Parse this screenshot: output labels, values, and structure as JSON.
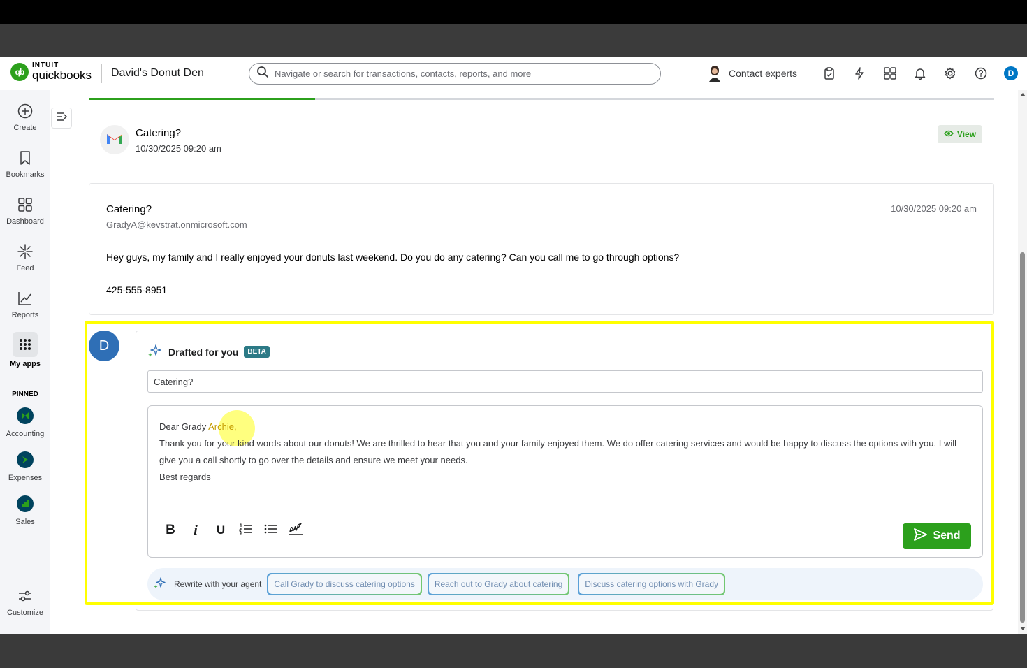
{
  "header": {
    "logo_top": "INTUIT",
    "logo_bottom": "quickbooks",
    "company": "David's Donut Den",
    "search_placeholder": "Navigate or search for transactions, contacts, reports, and more",
    "contact_experts": "Contact experts",
    "user_initial": "D"
  },
  "sidebar": {
    "items": [
      {
        "label": "Create",
        "icon": "plus-circle-icon"
      },
      {
        "label": "Bookmarks",
        "icon": "bookmark-icon"
      },
      {
        "label": "Dashboard",
        "icon": "dashboard-icon"
      },
      {
        "label": "Feed",
        "icon": "feed-icon"
      },
      {
        "label": "Reports",
        "icon": "reports-icon"
      },
      {
        "label": "My apps",
        "icon": "apps-grid-icon"
      }
    ],
    "pinned_label": "PINNED",
    "pinned": [
      {
        "label": "Accounting",
        "icon": "accounting-icon"
      },
      {
        "label": "Expenses",
        "icon": "expenses-icon"
      },
      {
        "label": "Sales",
        "icon": "sales-icon"
      }
    ],
    "customize": "Customize"
  },
  "email_header": {
    "title": "Catering?",
    "date": "10/30/2025 09:20 am",
    "view_label": "View"
  },
  "message": {
    "subject": "Catering?",
    "from": "GradyA@kevstrat.onmicrosoft.com",
    "date": "10/30/2025 09:20 am",
    "body": "Hey guys, my family and I really enjoyed your donuts last weekend. Do you do any catering? Can you call me to go through options?",
    "phone": "425-555-8951"
  },
  "draft": {
    "avatar": "D",
    "title": "Drafted for you",
    "badge": "BETA",
    "subject": "Catering?",
    "greeting_a": "Dear Grady ",
    "greeting_b": "Archie,",
    "line2": "Thank you for your kind words about our donuts! We are thrilled to hear that you and your family enjoyed them. We do offer catering services and would be happy to discuss the options with you. I will give you a call shortly to go over the details and ensure we meet your needs.",
    "line3": "Best regards",
    "send_label": "Send",
    "rewrite_label": "Rewrite with your agent",
    "suggestions": [
      "Call Grady to discuss catering options",
      "Reach out to Grady about catering",
      "Discuss catering options with Grady"
    ]
  },
  "colors": {
    "brand_green": "#2ca01c",
    "highlight_yellow": "#ffff00",
    "avatar_blue": "#2f6fb6"
  }
}
